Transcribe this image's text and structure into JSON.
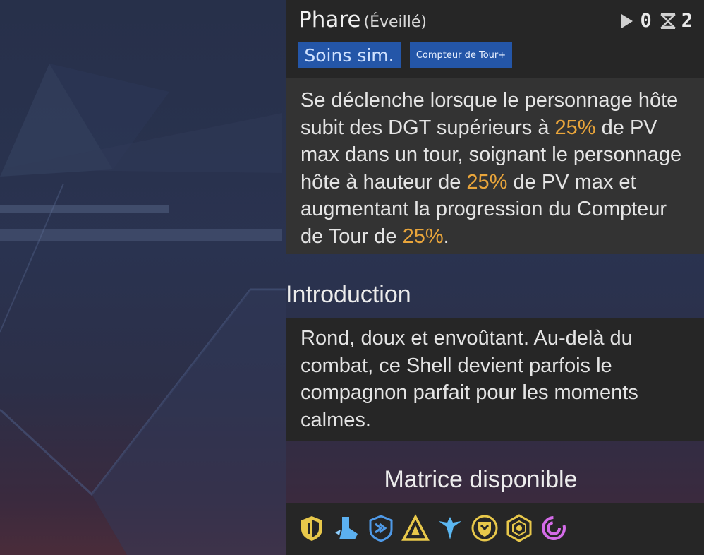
{
  "skill": {
    "title": "Phare",
    "subtitle": "(Éveillé)",
    "stats": [
      {
        "icon": "play-icon",
        "value": "0"
      },
      {
        "icon": "hourglass-icon",
        "value": "2"
      }
    ],
    "tags": [
      "Soins sim.",
      "Compteur de Tour+"
    ],
    "description": [
      {
        "t": "Se déclenche lorsque le personnage hôte subit des DGT supérieurs à ",
        "hl": false
      },
      {
        "t": "25%",
        "hl": true
      },
      {
        "t": " de PV max dans un tour, soignant le personnage hôte à hauteur de ",
        "hl": false
      },
      {
        "t": "25%",
        "hl": true
      },
      {
        "t": " de PV max et augmentant la progression du Compteur de Tour de ",
        "hl": false
      },
      {
        "t": "25%",
        "hl": true
      },
      {
        "t": ".",
        "hl": false
      }
    ]
  },
  "introduction": {
    "heading": "Introduction",
    "text": "Rond, doux et envoûtant. Au-delà du combat, ce Shell devient parfois le compagnon parfait pour les moments calmes."
  },
  "matrix": {
    "heading": "Matrice disponible",
    "icons": [
      {
        "name": "yellow-shield-icon",
        "color": "#e8c84a"
      },
      {
        "name": "blue-boot-icon",
        "color": "#5bb0f0"
      },
      {
        "name": "blue-emblem-icon",
        "color": "#4f9ae8"
      },
      {
        "name": "yellow-triangle-icon",
        "color": "#e8c84a"
      },
      {
        "name": "blue-wing-icon",
        "color": "#5bb8f2"
      },
      {
        "name": "yellow-crest-icon",
        "color": "#e8c84a"
      },
      {
        "name": "yellow-hex-icon",
        "color": "#e8c84a"
      },
      {
        "name": "purple-swirl-icon",
        "color": "#d46be8"
      }
    ]
  }
}
